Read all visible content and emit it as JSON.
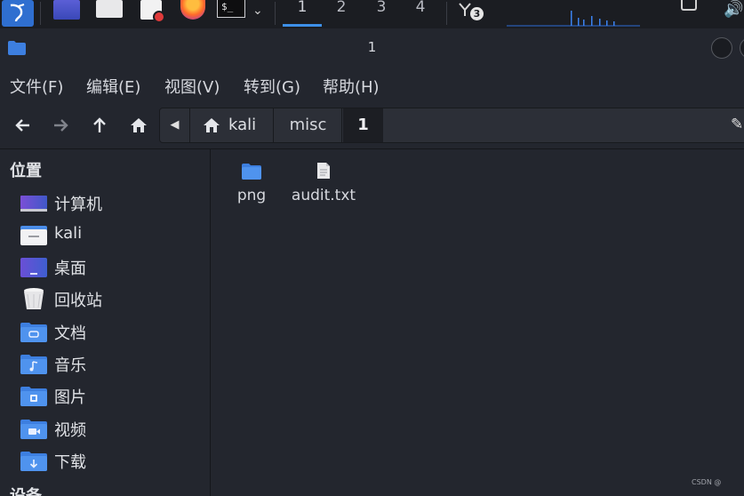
{
  "taskbar": {
    "workspaces": [
      "1",
      "2",
      "3",
      "4"
    ],
    "active_workspace": "1",
    "network_badge": "3"
  },
  "window": {
    "title": "1"
  },
  "menu": {
    "items": [
      "文件(F)",
      "编辑(E)",
      "视图(V)",
      "转到(G)",
      "帮助(H)"
    ]
  },
  "path": {
    "crumbs": [
      "kali",
      "misc",
      "1"
    ],
    "current": "1"
  },
  "sidebar": {
    "heading": "位置",
    "items": [
      {
        "label": "计算机",
        "icon": "computer-icon"
      },
      {
        "label": "kali",
        "icon": "home-folder-icon"
      },
      {
        "label": "桌面",
        "icon": "desktop-icon"
      },
      {
        "label": "回收站",
        "icon": "trash-icon"
      },
      {
        "label": "文档",
        "icon": "documents-folder-icon"
      },
      {
        "label": "音乐",
        "icon": "music-folder-icon"
      },
      {
        "label": "图片",
        "icon": "pictures-folder-icon"
      },
      {
        "label": "视频",
        "icon": "videos-folder-icon"
      },
      {
        "label": "下载",
        "icon": "downloads-folder-icon"
      }
    ],
    "heading_2": "设备"
  },
  "files": [
    {
      "name": "png",
      "icon": "folder-icon"
    },
    {
      "name": "audit.txt",
      "icon": "text-file-icon"
    }
  ],
  "watermark": "CSDN @"
}
